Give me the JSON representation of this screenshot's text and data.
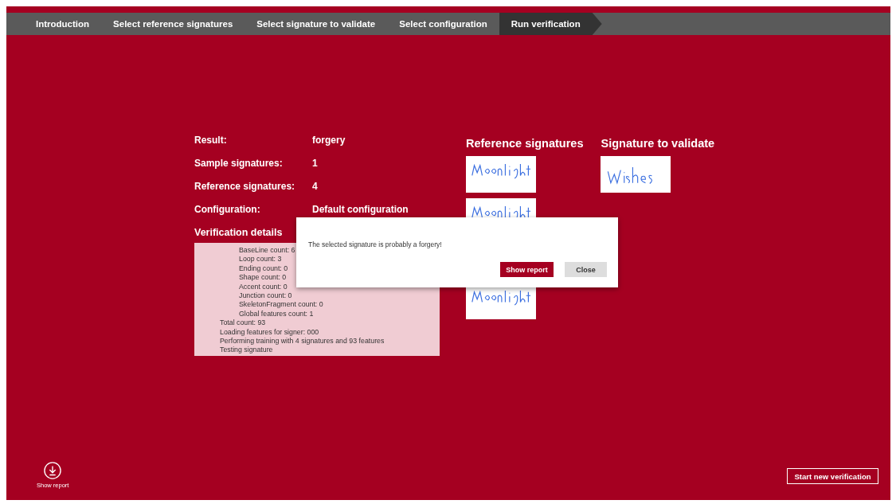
{
  "steps": [
    {
      "label": "Introduction",
      "selected": false
    },
    {
      "label": "Select reference signatures",
      "selected": false
    },
    {
      "label": "Select signature to validate",
      "selected": false
    },
    {
      "label": "Select configuration",
      "selected": false
    },
    {
      "label": "Run verification",
      "selected": true
    }
  ],
  "summary": [
    {
      "label": "Result:",
      "value": "forgery"
    },
    {
      "label": "Sample signatures:",
      "value": "1"
    },
    {
      "label": "Reference signatures:",
      "value": "4"
    },
    {
      "label": "Configuration:",
      "value": "Default configuration"
    }
  ],
  "details": {
    "heading": "Verification details",
    "log": [
      {
        "children": [
          {
            "text": "BaseLine count: 6"
          },
          {
            "text": "Loop count: 3"
          },
          {
            "text": "Ending count: 0"
          },
          {
            "text": "Shape count: 0"
          },
          {
            "text": "Accent count: 0"
          },
          {
            "text": "Junction count: 0"
          },
          {
            "text": "SkeletonFragment count: 0"
          },
          {
            "text": "Global features count: 1"
          }
        ]
      },
      {
        "text": "Total count: 93"
      },
      {
        "text": "Loading features for signer: 000"
      },
      {
        "text": "Performing training with 4 signatures and 93 features"
      },
      {
        "text": "Testing signature"
      }
    ]
  },
  "reference_signatures": {
    "heading": "Reference signatures"
  },
  "signature_to_validate": {
    "heading": "Signature to validate"
  },
  "dialog": {
    "message": "The selected signature is probably a forgery!",
    "buttons": [
      {
        "label": "Show report",
        "kind": "primary"
      },
      {
        "label": "Close",
        "kind": "secondary"
      }
    ]
  },
  "app_bar": {
    "show_report": "Show report",
    "start_new": "Start new verification"
  }
}
